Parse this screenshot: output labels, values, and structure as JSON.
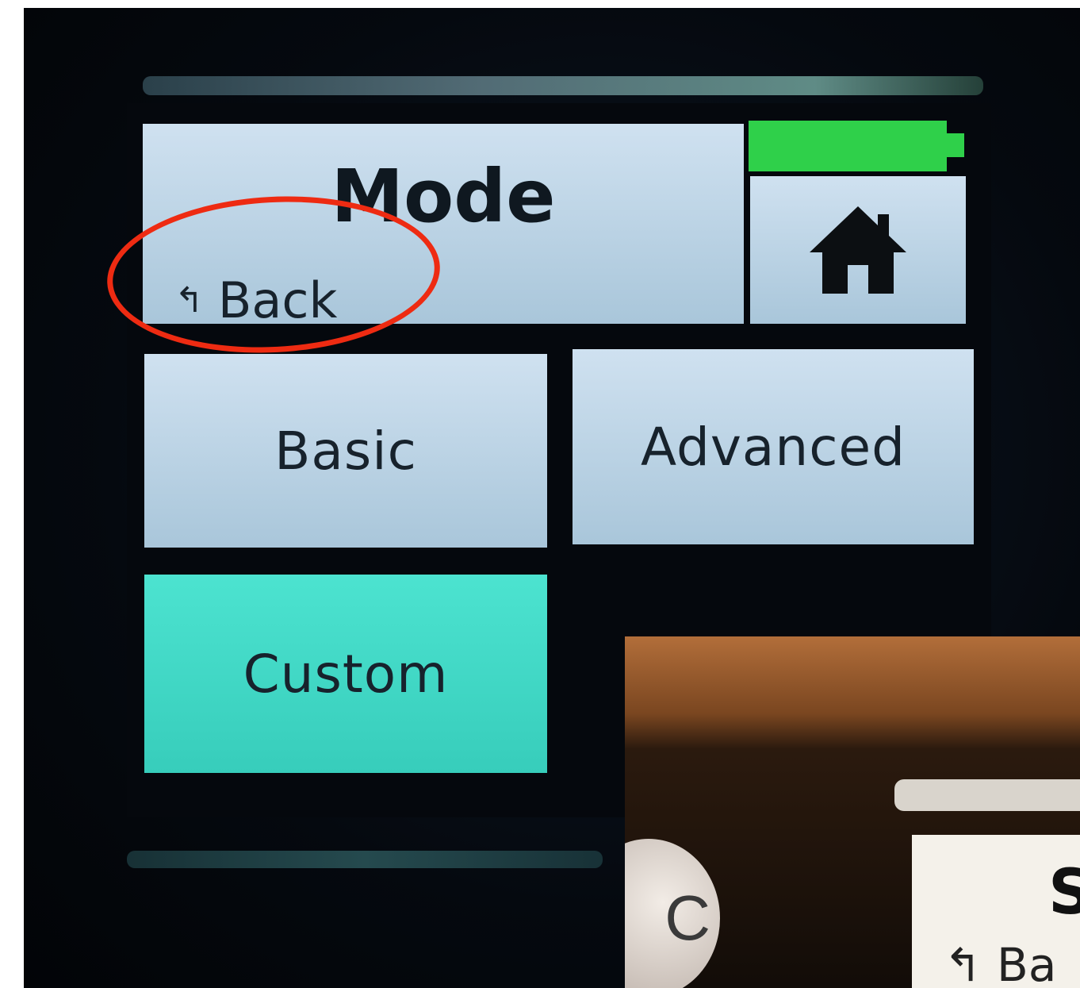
{
  "screen": {
    "title": "Mode",
    "back_label": "Back",
    "back_icon": "↰",
    "battery_level": 1.0,
    "battery_color": "#2fd04a",
    "home_icon": "home-icon",
    "options": [
      {
        "label": "Basic",
        "selected": false
      },
      {
        "label": "Advanced",
        "selected": false
      },
      {
        "label": "Custom",
        "selected": true
      }
    ]
  },
  "annotation": {
    "color": "#ee2b12",
    "target": "back-button"
  },
  "inset": {
    "knob_text": "C",
    "title_fragment": "S",
    "back_fragment": "Ba",
    "back_icon": "↰"
  }
}
